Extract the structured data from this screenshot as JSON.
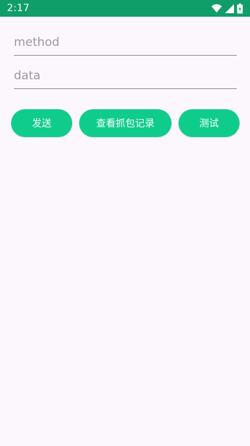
{
  "status_bar": {
    "time": "2:17",
    "background": "#0f9d6a",
    "icons": [
      "wifi-icon",
      "signal-icon",
      "battery-icon"
    ]
  },
  "form": {
    "method_placeholder": "method",
    "method_value": "",
    "data_placeholder": "data",
    "data_value": ""
  },
  "buttons": {
    "send_label": "发送",
    "view_capture_label": "查看抓包记录",
    "test_label": "测试",
    "color": "#0fcc8c"
  }
}
